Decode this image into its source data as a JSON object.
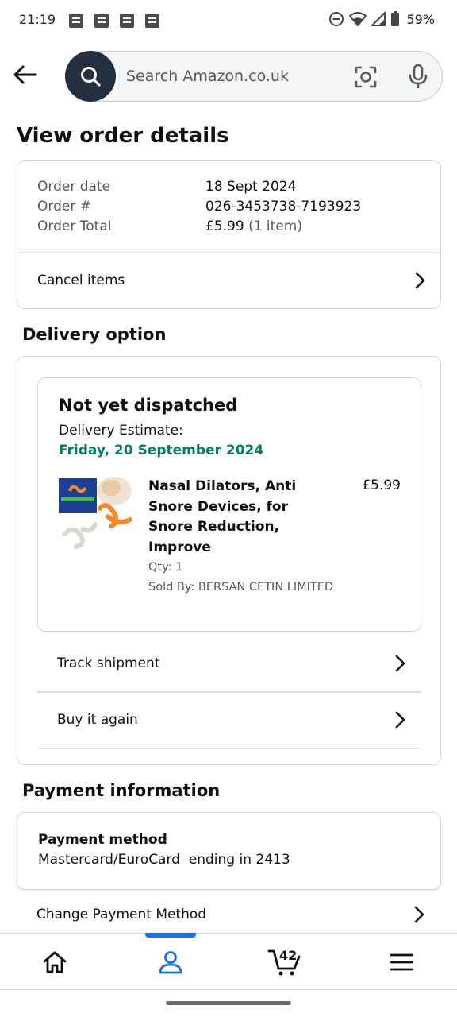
{
  "status_bar": {
    "time": "21:19",
    "battery": "59%"
  },
  "header": {
    "search_placeholder": "Search Amazon.co.uk"
  },
  "page_title": "View order details",
  "order_summary": {
    "rows": [
      {
        "label": "Order date",
        "value": "18 Sept 2024",
        "suffix": ""
      },
      {
        "label": "Order #",
        "value": "026-3453738-7193923",
        "suffix": ""
      },
      {
        "label": "Order Total",
        "value": "£5.99",
        "suffix": "(1 item)"
      }
    ],
    "cancel_label": "Cancel items"
  },
  "delivery": {
    "section_title": "Delivery option",
    "status": "Not yet dispatched",
    "estimate_label": "Delivery Estimate:",
    "estimate_date": "Friday, 20 September 2024",
    "estimate_color": "#067d62",
    "product": {
      "title": "Nasal Dilators, Anti Snore Devices, for Snore Reduction, Improve",
      "price": "£5.99",
      "qty": "Qty: 1",
      "seller": "Sold By: BERSAN CETIN LIMITED"
    },
    "track_label": "Track shipment",
    "buy_again_label": "Buy it again"
  },
  "payment": {
    "section_title": "Payment information",
    "method_label": "Payment method",
    "method_value": "Mastercard/EuroCard  ending in 2413",
    "change_label": "Change Payment Method"
  },
  "bottom_nav": {
    "cart_count": "42",
    "active_color": "#1f6fe0",
    "items": [
      "home-icon",
      "account-icon",
      "cart-icon",
      "menu-icon"
    ]
  }
}
